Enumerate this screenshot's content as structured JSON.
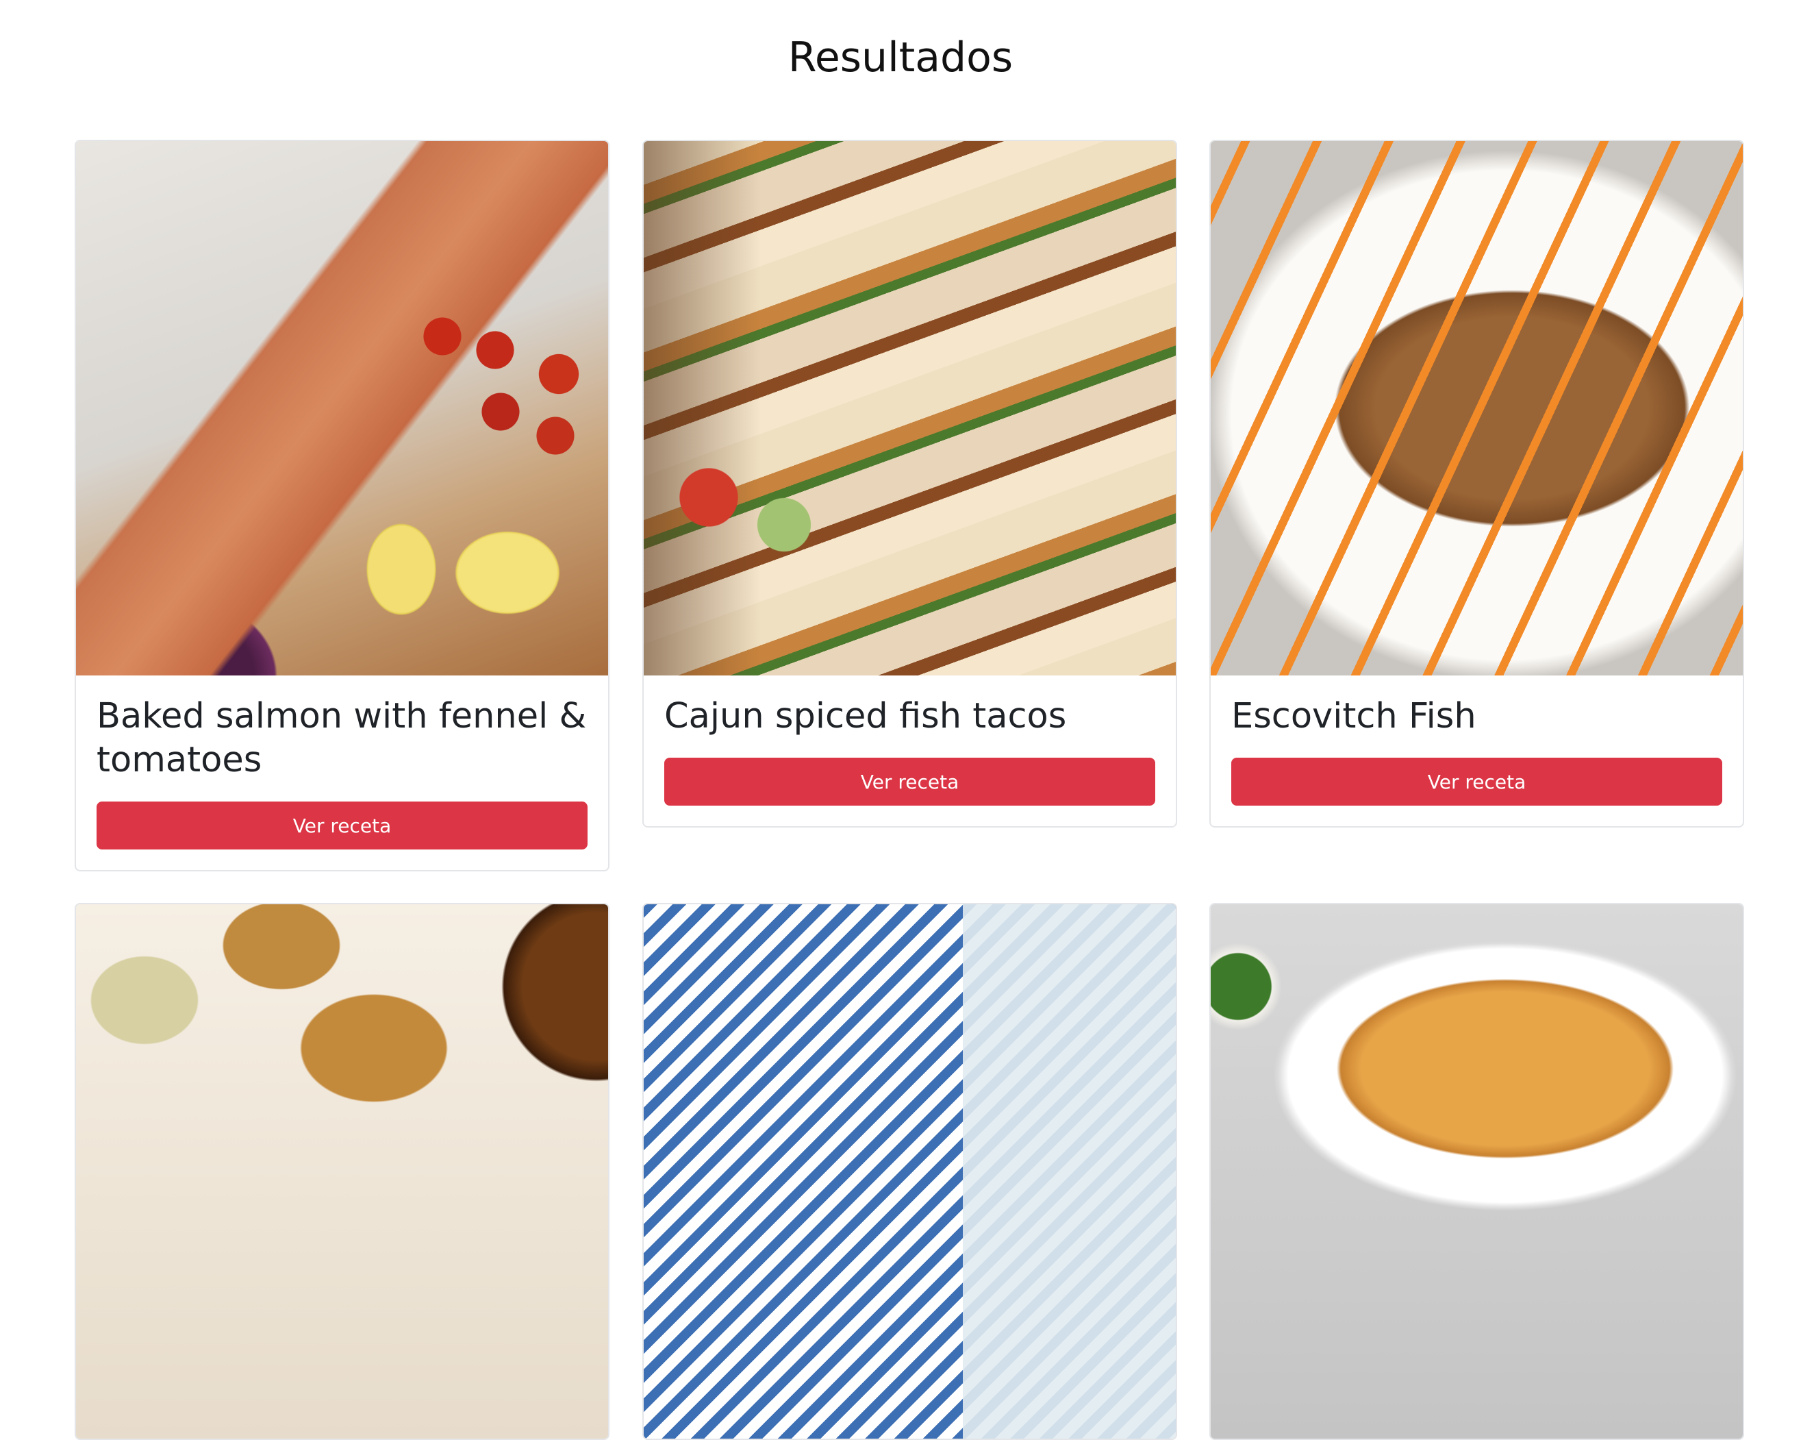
{
  "page": {
    "title": "Resultados"
  },
  "recipes": [
    {
      "title": "Baked salmon with fennel & tomatoes",
      "button_label": "Ver receta"
    },
    {
      "title": "Cajun spiced fish tacos",
      "button_label": "Ver receta"
    },
    {
      "title": "Escovitch Fish",
      "button_label": "Ver receta"
    },
    {
      "title": "",
      "button_label": ""
    },
    {
      "title": "",
      "button_label": ""
    },
    {
      "title": "",
      "button_label": ""
    }
  ],
  "colors": {
    "primary_button": "#dc3545",
    "card_border": "#e3e5e8"
  }
}
